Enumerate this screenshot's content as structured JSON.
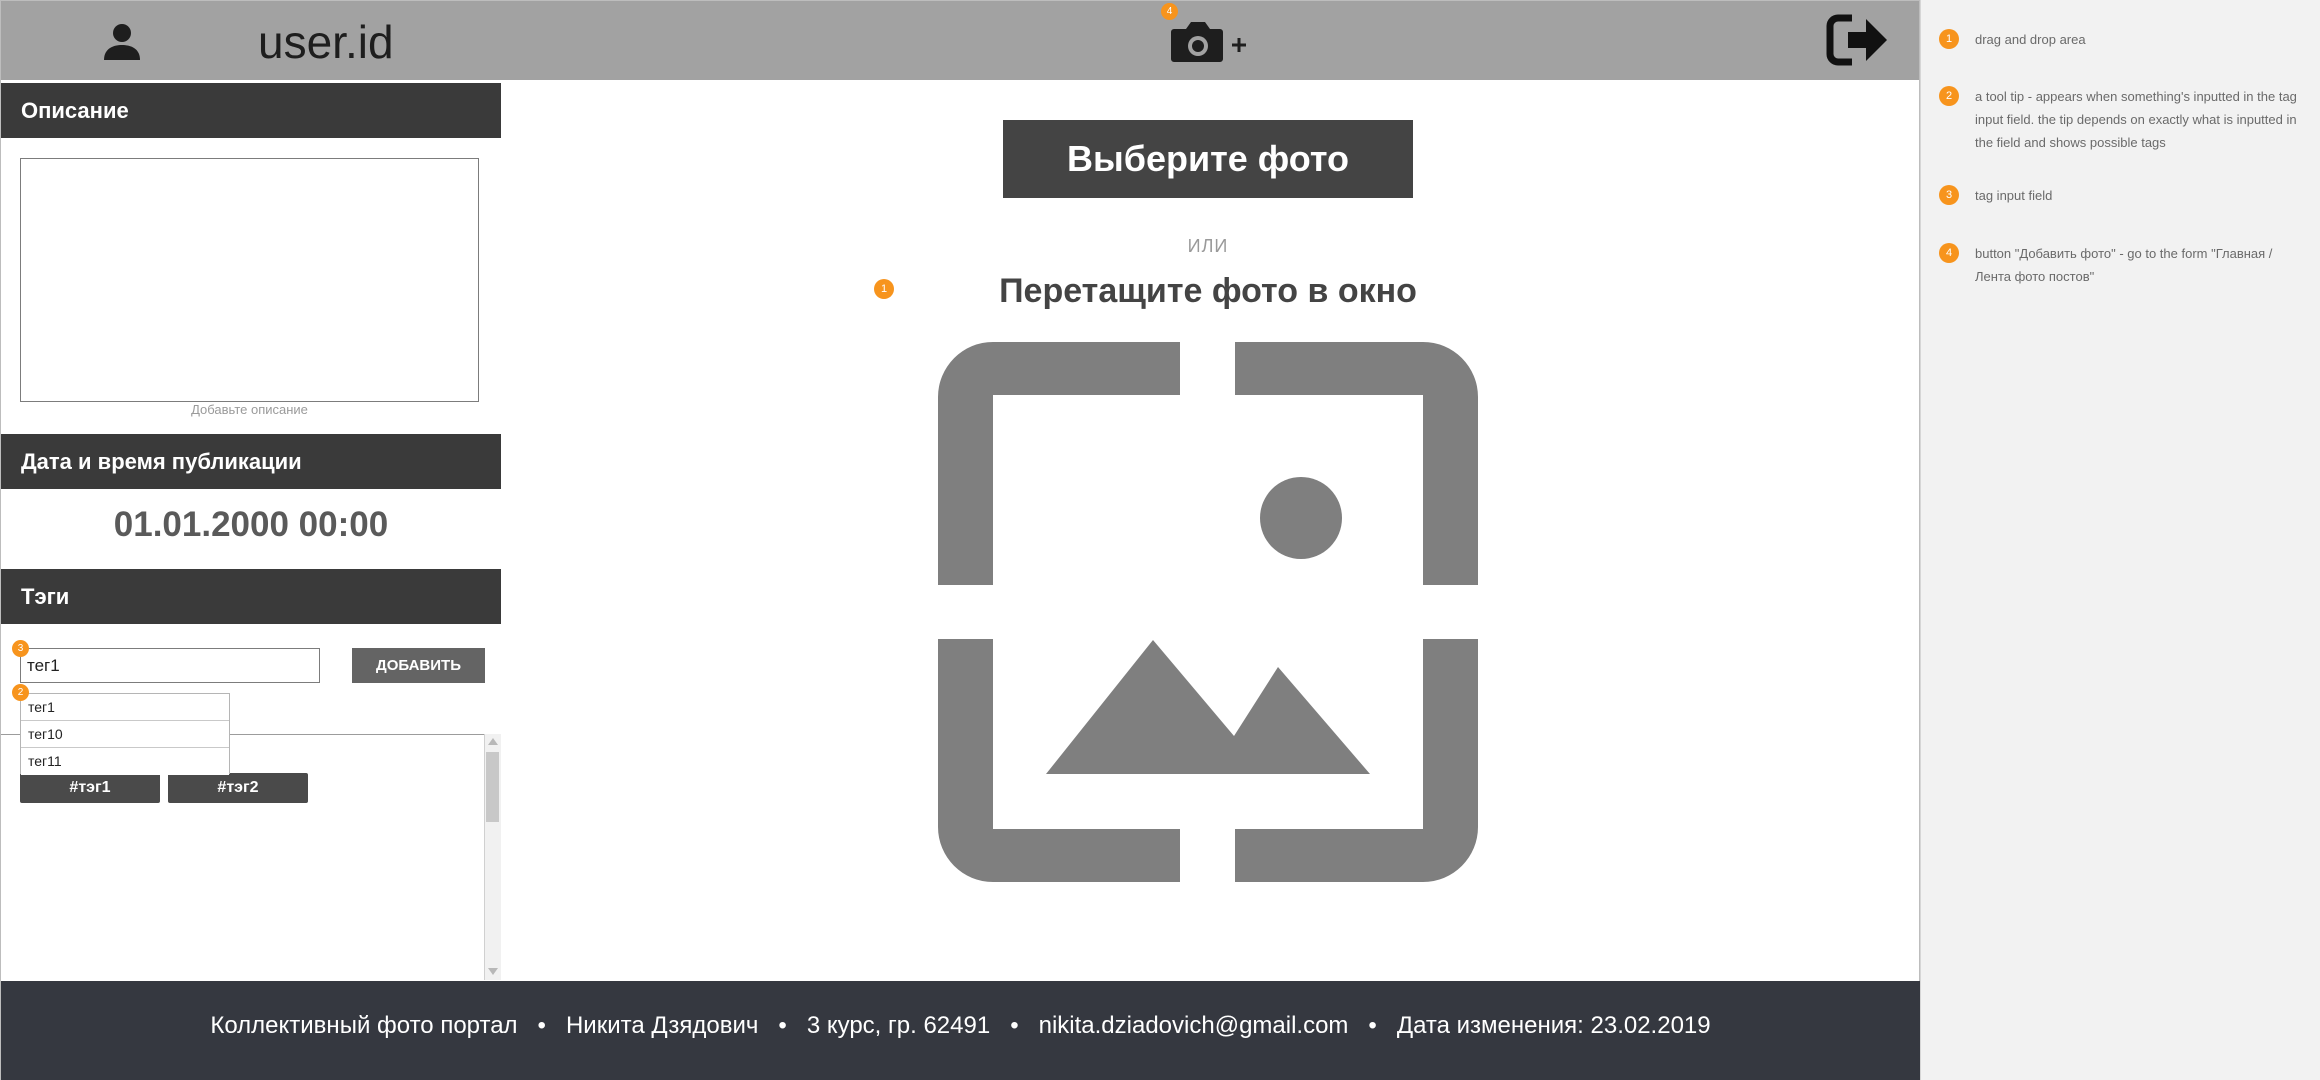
{
  "header": {
    "user_id": "user.id",
    "add_photo_marker": "4"
  },
  "sidebar": {
    "description": {
      "title": "Описание",
      "hint": "Добавьте описание"
    },
    "publication": {
      "title": "Дата и время публикации",
      "datetime": "01.01.2000 00:00"
    },
    "tags": {
      "title": "Тэги",
      "input_value": "тег1",
      "input_marker": "3",
      "add_button": "ДОБАВИТЬ",
      "tooltip_marker": "2",
      "suggestions": [
        "тег1",
        "тег10",
        "тег11"
      ],
      "chips": [
        "#тэг1",
        "#тэг2"
      ]
    }
  },
  "main": {
    "choose_button": "Выберите фото",
    "or_label": "ИЛИ",
    "drag_title": "Перетащите фото в окно",
    "drop_marker": "1"
  },
  "footer": {
    "text": "Коллективный фото портал   •   Никита Дзядович   •   3 курс, гр. 62491   •   nikita.dziadovich@gmail.com   •   Дата изменения: 23.02.2019"
  },
  "notes": [
    {
      "num": "1",
      "text": "drag and drop area"
    },
    {
      "num": "2",
      "text": "a tool tip - appears when something's inputted in the tag input field. the tip depends on exactly what is inputted in the field and shows possible tags"
    },
    {
      "num": "3",
      "text": "tag input field"
    },
    {
      "num": "4",
      "text": "button \"Добавить фото\" - go to the form \"Главная / Лента фото постов\""
    }
  ],
  "colors": {
    "header": "#a2a2a2",
    "section_header": "#3a3a3a",
    "footer": "#353840",
    "marker": "#f7941d",
    "drop_icon": "#7f7f7f"
  },
  "icons": [
    "user-icon",
    "camera-plus-icon",
    "logout-icon",
    "image-drop-icon"
  ]
}
